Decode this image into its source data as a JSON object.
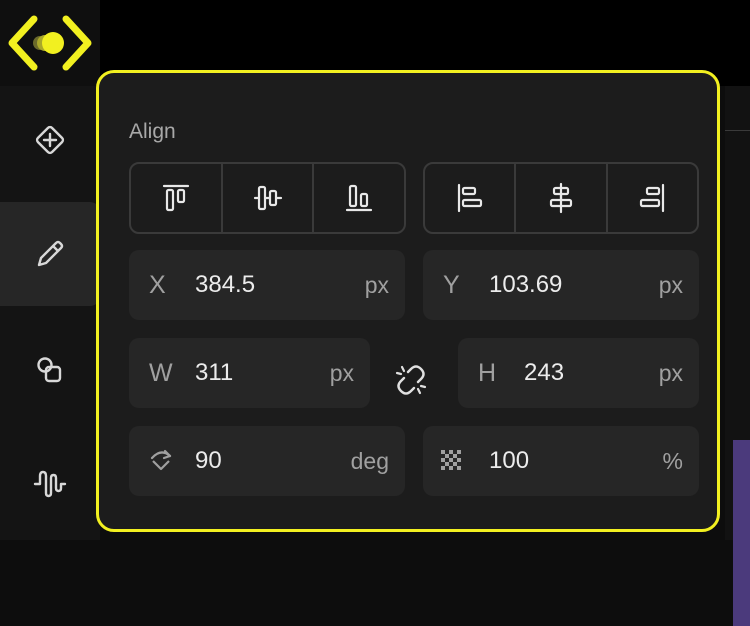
{
  "panel": {
    "title": "Align"
  },
  "fields": {
    "x": {
      "label": "X",
      "value": "384.5",
      "unit": "px"
    },
    "y": {
      "label": "Y",
      "value": "103.69",
      "unit": "px"
    },
    "w": {
      "label": "W",
      "value": "311",
      "unit": "px"
    },
    "h": {
      "label": "H",
      "value": "243",
      "unit": "px"
    },
    "rotation": {
      "icon": "rotation-icon",
      "value": "90",
      "unit": "deg"
    },
    "opacity": {
      "icon": "opacity-checker-icon",
      "value": "100",
      "unit": "%"
    }
  },
  "align_buttons": [
    "align-top-icon",
    "align-vertical-center-icon",
    "align-bottom-icon",
    "align-left-icon",
    "align-horizontal-center-icon",
    "align-right-icon"
  ],
  "sidebar_icons": [
    "add-icon",
    "pencil-icon",
    "shapes-icon",
    "waveform-icon"
  ],
  "colors": {
    "accent": "#f2f020",
    "panel": "#1c1c1c",
    "field": "#262626"
  }
}
